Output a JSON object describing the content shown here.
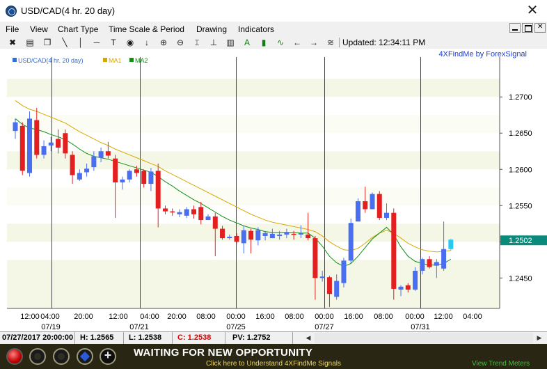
{
  "window": {
    "title": "USD/CAD(4 hr.  20 day)",
    "close_glyph": "✕"
  },
  "menu": [
    "File",
    "View",
    "Chart Type",
    "Time Scale & Period",
    "Drawing",
    "Indicators"
  ],
  "toolbar": {
    "icons": [
      "cross-chart-icon",
      "print-icon",
      "copy-icon",
      "trend-line-icon",
      "vertical-line-icon",
      "horizontal-line-icon",
      "text-tool-icon",
      "target-icon",
      "down-arrow-icon",
      "zoom-in-icon",
      "zoom-out-icon",
      "fit-icon",
      "baseline-icon",
      "bar-chart-icon",
      "label-a-icon",
      "volume-bars-icon",
      "wave-icon",
      "left-arrow-icon",
      "right-arrow-icon",
      "list-icon"
    ],
    "updated_label": "Updated: 12:34:11 PM"
  },
  "chart_data": {
    "type": "candlestick",
    "brand_label": "4XFindMe by ForexSignal",
    "legend": [
      {
        "name": "USD/CAD(4 hr.  20 day)",
        "color": "#2f6fd8"
      },
      {
        "name": "MA1",
        "color": "#d8a800"
      },
      {
        "name": "MA2",
        "color": "#109010"
      }
    ],
    "y_ticks": [
      "1.2700",
      "1.2650",
      "1.2600",
      "1.2550",
      "1.2500",
      "1.2450"
    ],
    "y_tick_values": [
      1.27,
      1.265,
      1.26,
      1.255,
      1.25,
      1.245
    ],
    "ylim": [
      1.2408,
      1.2755
    ],
    "current_price_label": "1.2502",
    "current_price": 1.2502,
    "x_time_labels": [
      "12:00",
      "04:00",
      "20:00",
      "12:00",
      "04:00",
      "20:00",
      "08:00",
      "00:00",
      "16:00",
      "08:00",
      "00:00",
      "16:00",
      "08:00",
      "00:00",
      "12:00",
      "04:00"
    ],
    "x_date_labels": [
      "07/19",
      "07/21",
      "07/25",
      "07/27",
      "07/31"
    ],
    "up_color": "#4a6ef0",
    "down_color": "#e31f1f",
    "last_candle_color": "#2ac8f0",
    "candles": [
      {
        "o": 1.2653,
        "h": 1.267,
        "l": 1.2642,
        "c": 1.2665
      },
      {
        "o": 1.266,
        "h": 1.2665,
        "l": 1.2592,
        "c": 1.2598
      },
      {
        "o": 1.2595,
        "h": 1.268,
        "l": 1.259,
        "c": 1.267
      },
      {
        "o": 1.2668,
        "h": 1.2685,
        "l": 1.2615,
        "c": 1.262
      },
      {
        "o": 1.262,
        "h": 1.264,
        "l": 1.2615,
        "c": 1.2632
      },
      {
        "o": 1.2633,
        "h": 1.2645,
        "l": 1.2625,
        "c": 1.2637
      },
      {
        "o": 1.2642,
        "h": 1.2655,
        "l": 1.2622,
        "c": 1.263
      },
      {
        "o": 1.265,
        "h": 1.2655,
        "l": 1.2615,
        "c": 1.2622
      },
      {
        "o": 1.262,
        "h": 1.2625,
        "l": 1.258,
        "c": 1.2592
      },
      {
        "o": 1.2586,
        "h": 1.26,
        "l": 1.2584,
        "c": 1.2595
      },
      {
        "o": 1.2596,
        "h": 1.2608,
        "l": 1.259,
        "c": 1.2601
      },
      {
        "o": 1.2603,
        "h": 1.2625,
        "l": 1.2598,
        "c": 1.2618
      },
      {
        "o": 1.2616,
        "h": 1.263,
        "l": 1.261,
        "c": 1.2625
      },
      {
        "o": 1.2625,
        "h": 1.2638,
        "l": 1.2615,
        "c": 1.2619
      },
      {
        "o": 1.2615,
        "h": 1.262,
        "l": 1.2533,
        "c": 1.2582
      },
      {
        "o": 1.2582,
        "h": 1.259,
        "l": 1.2572,
        "c": 1.2586
      },
      {
        "o": 1.2586,
        "h": 1.26,
        "l": 1.2582,
        "c": 1.2598
      },
      {
        "o": 1.26,
        "h": 1.2605,
        "l": 1.259,
        "c": 1.2595
      },
      {
        "o": 1.2598,
        "h": 1.26,
        "l": 1.2575,
        "c": 1.258
      },
      {
        "o": 1.258,
        "h": 1.2602,
        "l": 1.257,
        "c": 1.2597
      },
      {
        "o": 1.2598,
        "h": 1.2608,
        "l": 1.252,
        "c": 1.2546
      },
      {
        "o": 1.2546,
        "h": 1.255,
        "l": 1.2538,
        "c": 1.2542
      },
      {
        "o": 1.2542,
        "h": 1.2546,
        "l": 1.2536,
        "c": 1.2541
      },
      {
        "o": 1.2538,
        "h": 1.2545,
        "l": 1.2534,
        "c": 1.2541
      },
      {
        "o": 1.2536,
        "h": 1.2548,
        "l": 1.2533,
        "c": 1.2545
      },
      {
        "o": 1.2545,
        "h": 1.255,
        "l": 1.2532,
        "c": 1.2538
      },
      {
        "o": 1.2548,
        "h": 1.2555,
        "l": 1.2524,
        "c": 1.253
      },
      {
        "o": 1.253,
        "h": 1.2538,
        "l": 1.253,
        "c": 1.2535
      },
      {
        "o": 1.2535,
        "h": 1.254,
        "l": 1.248,
        "c": 1.2518
      },
      {
        "o": 1.2518,
        "h": 1.2522,
        "l": 1.2503,
        "c": 1.2505
      },
      {
        "o": 1.2505,
        "h": 1.251,
        "l": 1.2503,
        "c": 1.2507
      },
      {
        "o": 1.2508,
        "h": 1.2512,
        "l": 1.2498,
        "c": 1.25
      },
      {
        "o": 1.2498,
        "h": 1.2522,
        "l": 1.2484,
        "c": 1.2516
      },
      {
        "o": 1.2515,
        "h": 1.2518,
        "l": 1.2484,
        "c": 1.2503
      },
      {
        "o": 1.2502,
        "h": 1.252,
        "l": 1.2495,
        "c": 1.2516
      },
      {
        "o": 1.2508,
        "h": 1.2515,
        "l": 1.2502,
        "c": 1.2512
      },
      {
        "o": 1.2505,
        "h": 1.2518,
        "l": 1.2505,
        "c": 1.2511
      },
      {
        "o": 1.2508,
        "h": 1.2515,
        "l": 1.2503,
        "c": 1.251
      },
      {
        "o": 1.251,
        "h": 1.2518,
        "l": 1.2505,
        "c": 1.2513
      },
      {
        "o": 1.2511,
        "h": 1.2515,
        "l": 1.2503,
        "c": 1.251
      },
      {
        "o": 1.251,
        "h": 1.2523,
        "l": 1.2505,
        "c": 1.2512
      },
      {
        "o": 1.251,
        "h": 1.254,
        "l": 1.2502,
        "c": 1.2505
      },
      {
        "o": 1.2505,
        "h": 1.2508,
        "l": 1.242,
        "c": 1.245
      },
      {
        "o": 1.245,
        "h": 1.246,
        "l": 1.2445,
        "c": 1.2452
      },
      {
        "o": 1.2451,
        "h": 1.2453,
        "l": 1.241,
        "c": 1.2428
      },
      {
        "o": 1.2424,
        "h": 1.2455,
        "l": 1.242,
        "c": 1.2446
      },
      {
        "o": 1.2443,
        "h": 1.2478,
        "l": 1.2437,
        "c": 1.2474
      },
      {
        "o": 1.2474,
        "h": 1.2532,
        "l": 1.247,
        "c": 1.2526
      },
      {
        "o": 1.2528,
        "h": 1.256,
        "l": 1.2528,
        "c": 1.2556
      },
      {
        "o": 1.2556,
        "h": 1.2576,
        "l": 1.254,
        "c": 1.2545
      },
      {
        "o": 1.2545,
        "h": 1.2568,
        "l": 1.2545,
        "c": 1.2566
      },
      {
        "o": 1.2566,
        "h": 1.257,
        "l": 1.253,
        "c": 1.2533
      },
      {
        "o": 1.2533,
        "h": 1.2553,
        "l": 1.253,
        "c": 1.254
      },
      {
        "o": 1.254,
        "h": 1.2546,
        "l": 1.242,
        "c": 1.2435
      },
      {
        "o": 1.2434,
        "h": 1.244,
        "l": 1.2425,
        "c": 1.2438
      },
      {
        "o": 1.244,
        "h": 1.2443,
        "l": 1.243,
        "c": 1.2434
      },
      {
        "o": 1.2434,
        "h": 1.2465,
        "l": 1.2432,
        "c": 1.246
      },
      {
        "o": 1.246,
        "h": 1.2478,
        "l": 1.2455,
        "c": 1.2476
      },
      {
        "o": 1.2476,
        "h": 1.248,
        "l": 1.2463,
        "c": 1.2465
      },
      {
        "o": 1.2467,
        "h": 1.2476,
        "l": 1.245,
        "c": 1.2472
      },
      {
        "o": 1.2463,
        "h": 1.2528,
        "l": 1.246,
        "c": 1.249
      },
      {
        "o": 1.249,
        "h": 1.2504,
        "l": 1.2488,
        "c": 1.2503
      }
    ],
    "ma1": [
      1.2695,
      1.2688,
      1.2683,
      1.268,
      1.2676,
      1.2672,
      1.2668,
      1.2664,
      1.2658,
      1.2652,
      1.2647,
      1.2642,
      1.2637,
      1.2633,
      1.2628,
      1.2624,
      1.262,
      1.2616,
      1.2612,
      1.2608,
      1.2604,
      1.2598,
      1.2593,
      1.2588,
      1.2583,
      1.2578,
      1.2573,
      1.2568,
      1.2563,
      1.2558,
      1.2553,
      1.2548,
      1.2543,
      1.2538,
      1.2534,
      1.253,
      1.2527,
      1.2525,
      1.2523,
      1.2521,
      1.2519,
      1.2517,
      1.2514,
      1.2508,
      1.25,
      1.2494,
      1.2489,
      1.2488,
      1.2491,
      1.2498,
      1.2506,
      1.2512,
      1.2516,
      1.2512,
      1.2505,
      1.2498,
      1.2493,
      1.2489,
      1.2487,
      1.2486,
      1.2487,
      1.2488
    ],
    "ma2": [
      1.267,
      1.2662,
      1.2657,
      1.2655,
      1.2652,
      1.2648,
      1.2645,
      1.2641,
      1.2635,
      1.2628,
      1.2622,
      1.2618,
      1.2616,
      1.2614,
      1.2611,
      1.2608,
      1.2605,
      1.2602,
      1.2599,
      1.2596,
      1.259,
      1.2583,
      1.2577,
      1.257,
      1.2564,
      1.2558,
      1.2553,
      1.2547,
      1.2541,
      1.2535,
      1.253,
      1.2526,
      1.2522,
      1.2519,
      1.2517,
      1.2514,
      1.2513,
      1.2513,
      1.2513,
      1.2513,
      1.2512,
      1.2512,
      1.2505,
      1.2494,
      1.248,
      1.2471,
      1.2466,
      1.247,
      1.248,
      1.2492,
      1.2504,
      1.2512,
      1.252,
      1.251,
      1.2493,
      1.248,
      1.2473,
      1.247,
      1.2468,
      1.2468,
      1.247,
      1.2476
    ]
  },
  "status": {
    "datetime": "07/27/2017 20:00:00",
    "high": "H: 1.2565",
    "low": "L: 1.2538",
    "close": "C: 1.2538",
    "pv": "PV: 1.2752"
  },
  "bottom": {
    "headline": "WAITING FOR NEW OPPORTUNITY",
    "subline": "Click here to Understand 4XFindMe Signals",
    "trend_link": "View Trend Meters"
  }
}
